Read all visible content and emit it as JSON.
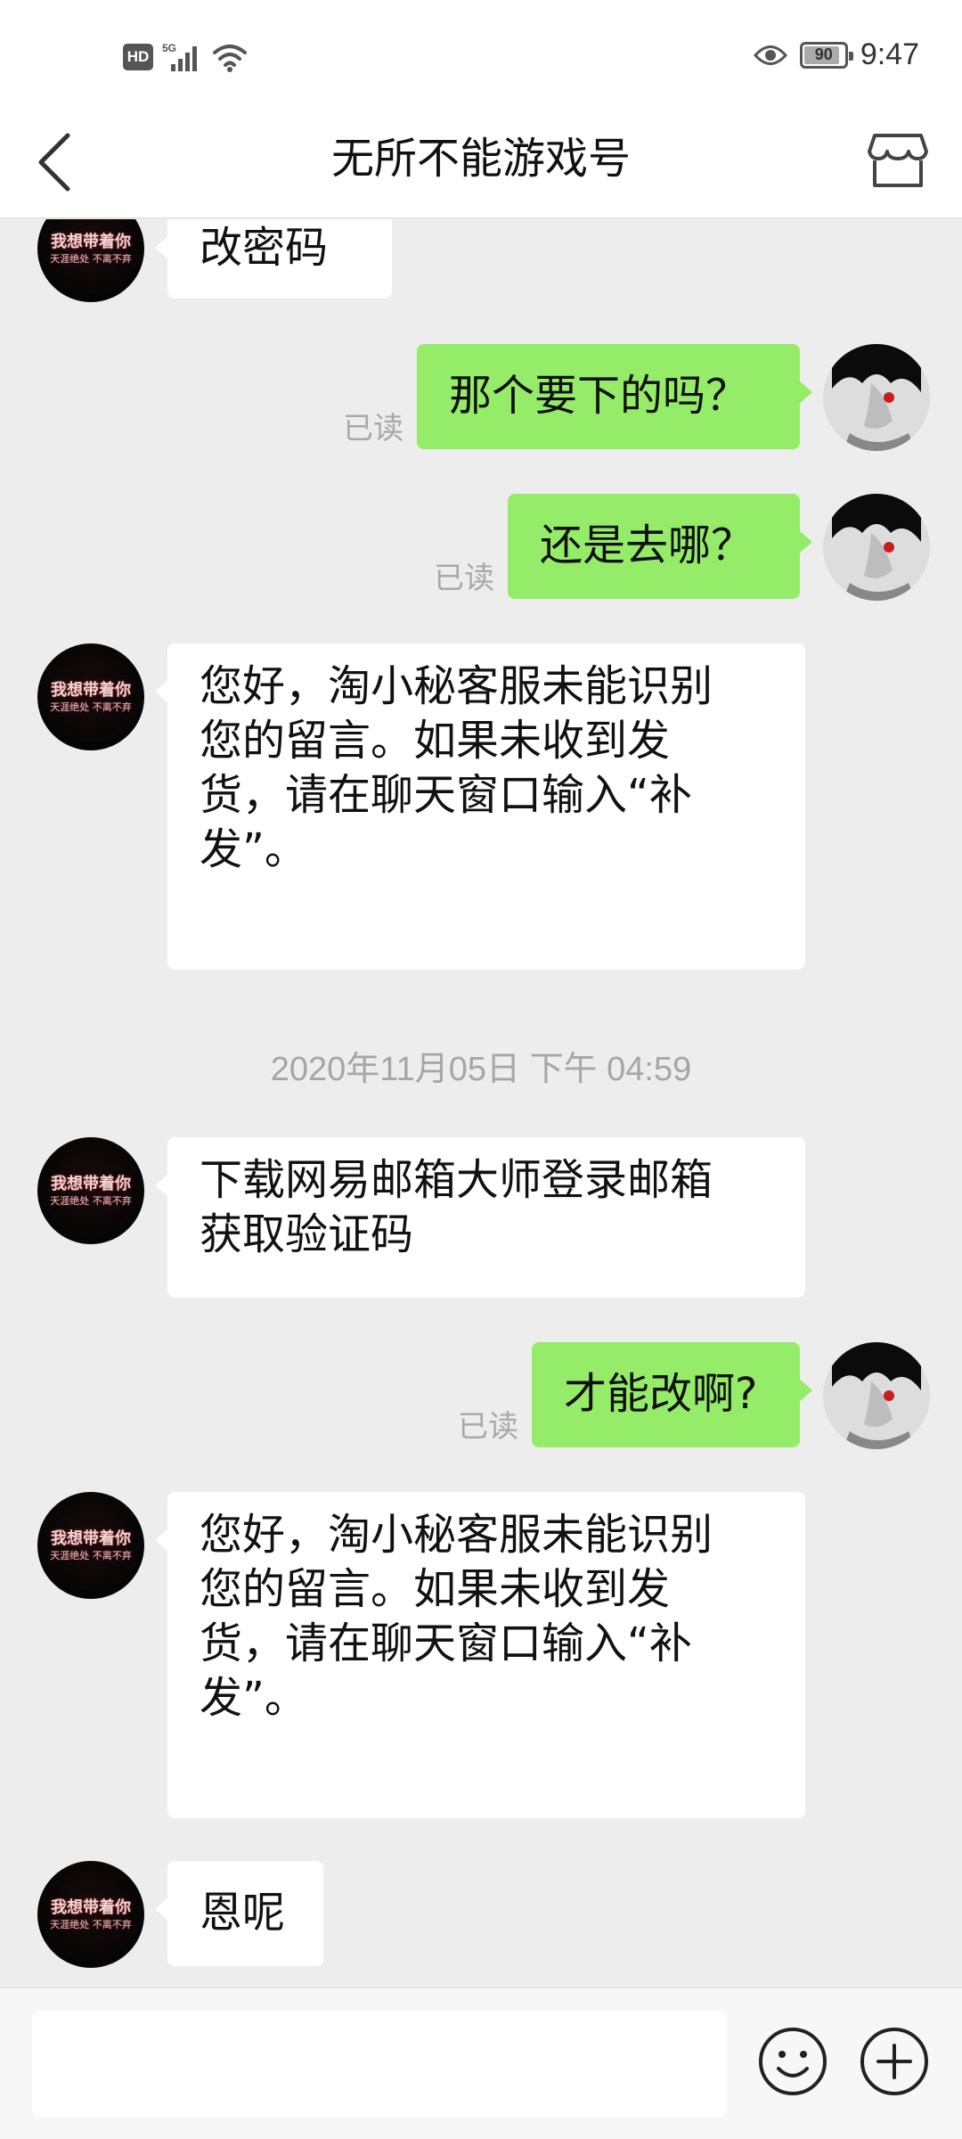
{
  "status_bar": {
    "hd": "HD",
    "network": "5G",
    "battery": "90",
    "battery_level": 0.9,
    "time": "9:47"
  },
  "nav": {
    "title": "无所不能游戏号",
    "back_icon": "chevron-left-icon",
    "shop_icon": "store-icon"
  },
  "avatars": {
    "seller_line1": "我想带着你",
    "seller_line2": "天涯绝处 不离不弃"
  },
  "messages": [
    {
      "side": "in",
      "text": "改密码"
    },
    {
      "side": "out",
      "text": "那个要下的吗？",
      "read": "已读"
    },
    {
      "side": "out",
      "text": "还是去哪？",
      "read": "已读"
    },
    {
      "side": "in",
      "lines": [
        "您好，淘小秘客服未能识别",
        "您的留言。如果未收到发",
        "货，请在聊天窗口输入“补",
        "发”。"
      ]
    },
    {
      "side": "in",
      "lines": [
        "下载网易邮箱大师登录邮箱",
        "获取验证码"
      ]
    },
    {
      "side": "out",
      "text": "才能改啊?",
      "read": "已读"
    },
    {
      "side": "in",
      "lines": [
        "您好，淘小秘客服未能识别",
        "您的留言。如果未收到发",
        "货，请在聊天窗口输入“补",
        "发”。"
      ]
    },
    {
      "side": "in",
      "text": "恩呢"
    }
  ],
  "timestamp": "2020年11月05日 下午 04:59",
  "input": {
    "value": "",
    "emoji_icon": "emoji-icon",
    "plus_icon": "plus-icon"
  },
  "colors": {
    "outgoing_bubble": "#95ec69",
    "incoming_bubble": "#ffffff",
    "chat_background": "#ededed"
  }
}
